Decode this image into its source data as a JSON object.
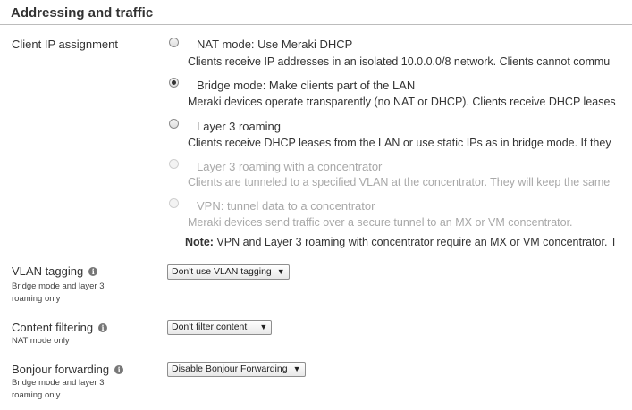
{
  "section": {
    "title": "Addressing and traffic"
  },
  "client_ip": {
    "label": "Client IP assignment",
    "options": [
      {
        "title": "NAT mode: Use Meraki DHCP",
        "desc": "Clients receive IP addresses in an isolated 10.0.0.0/8 network. Clients cannot commu",
        "selected": false,
        "disabled": false
      },
      {
        "title": "Bridge mode: Make clients part of the LAN",
        "desc": "Meraki devices operate transparently (no NAT or DHCP). Clients receive DHCP leases",
        "selected": true,
        "disabled": false
      },
      {
        "title": "Layer 3 roaming",
        "desc": "Clients receive DHCP leases from the LAN or use static IPs as in bridge mode. If they",
        "selected": false,
        "disabled": false
      },
      {
        "title": "Layer 3 roaming with a concentrator",
        "desc": "Clients are tunneled to a specified VLAN at the concentrator. They will keep the same",
        "selected": false,
        "disabled": true
      },
      {
        "title": "VPN: tunnel data to a concentrator",
        "desc": "Meraki devices send traffic over a secure tunnel to an MX or VM concentrator.",
        "selected": false,
        "disabled": true
      }
    ],
    "note_label": "Note:",
    "note_text": " VPN and Layer 3 roaming with concentrator require an MX or VM concentrator. T"
  },
  "vlan": {
    "label": "VLAN tagging",
    "sub": "Bridge mode and layer 3 roaming only",
    "value": "Don't use VLAN tagging",
    "icon": "info-icon"
  },
  "content_filter": {
    "label": "Content filtering",
    "sub": "NAT mode only",
    "value": "Don't filter content",
    "icon": "info-icon"
  },
  "bonjour": {
    "label": "Bonjour forwarding",
    "sub": "Bridge mode and layer 3 roaming only",
    "value": "Disable Bonjour Forwarding",
    "icon": "info-icon"
  },
  "glyphs": {
    "info": "i",
    "dropdown": "▼"
  }
}
